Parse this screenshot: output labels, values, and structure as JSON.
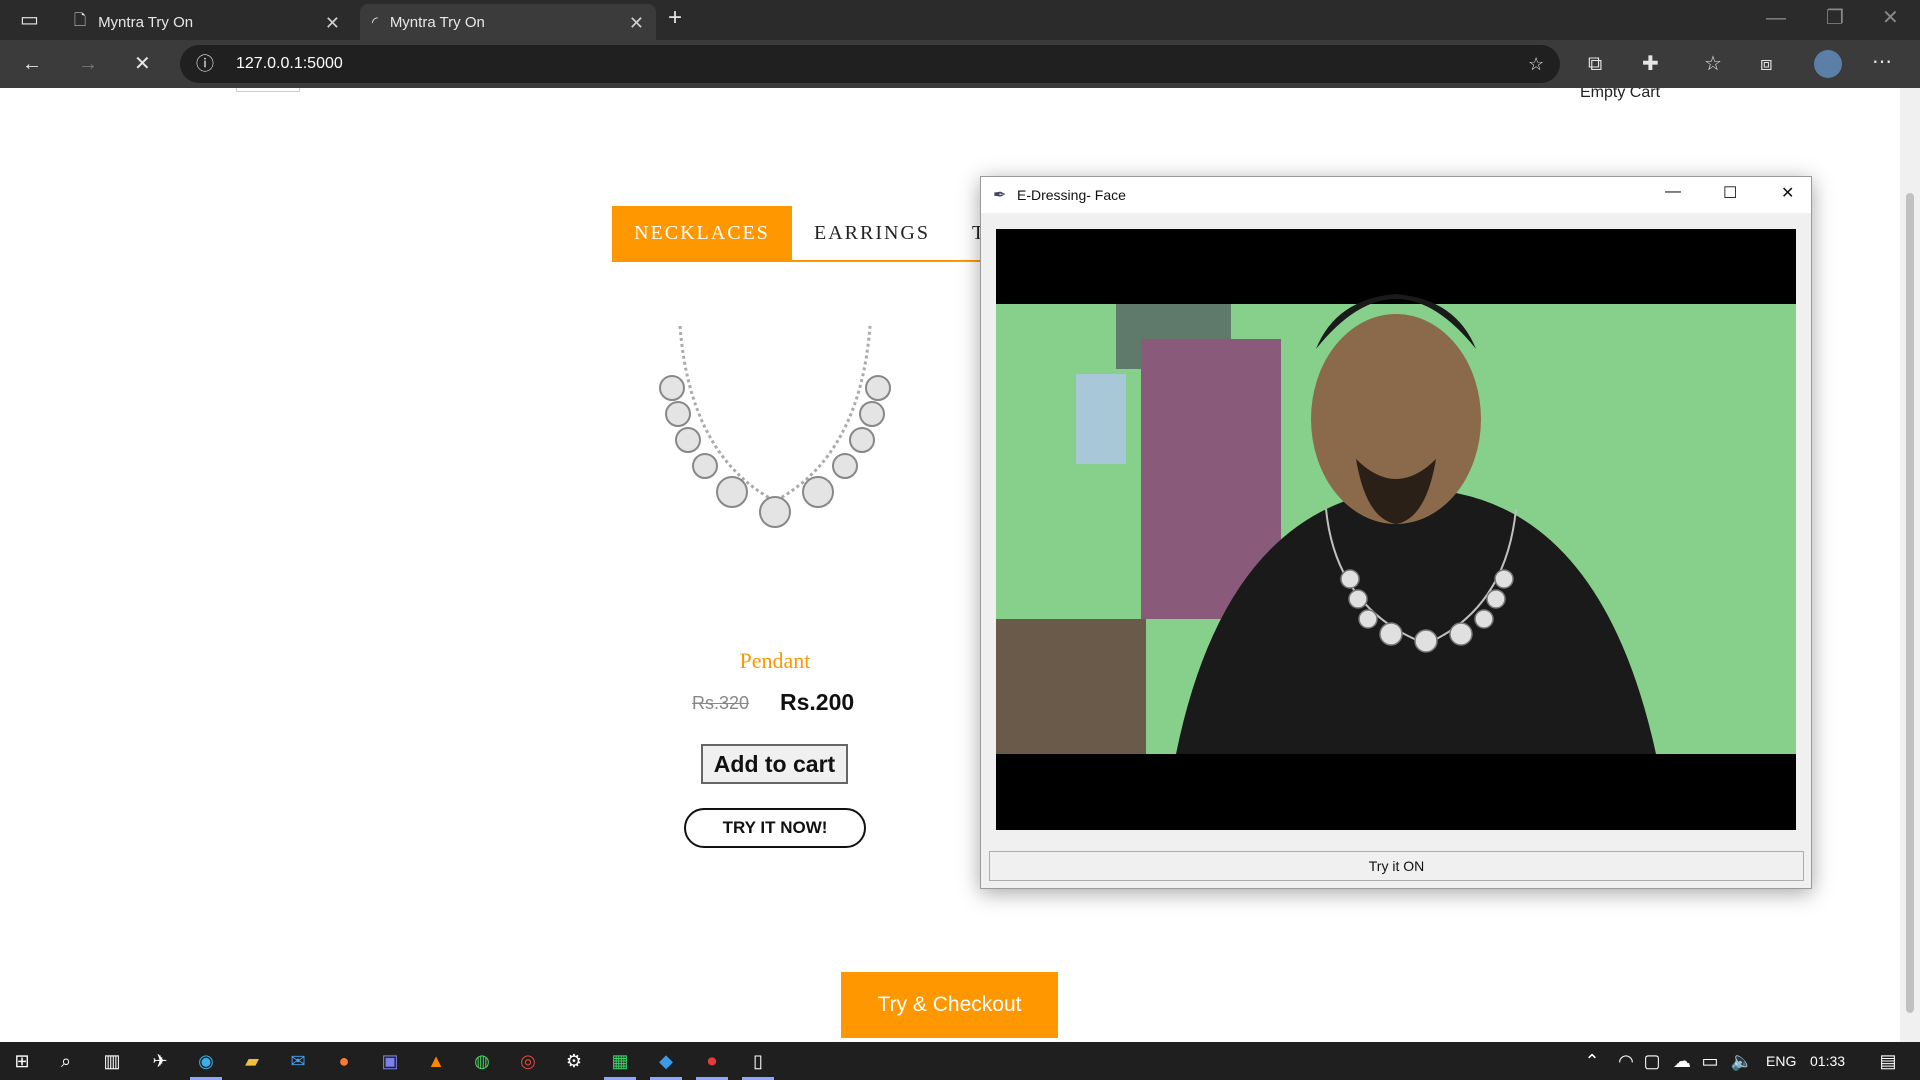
{
  "browser": {
    "tabs": [
      {
        "title": "Myntra Try On"
      },
      {
        "title": "Myntra Try On"
      }
    ],
    "url": "127.0.0.1:5000"
  },
  "page": {
    "empty_cart": "Empty Cart",
    "categories": [
      "NECKLACES",
      "EARRINGS",
      "T"
    ],
    "product": {
      "name": "Pendant",
      "old_price": "Rs.320",
      "new_price": "Rs.200",
      "add_to_cart": "Add to cart",
      "try_now": "TRY IT NOW!"
    },
    "checkout": "Try & Checkout"
  },
  "popup": {
    "title": "E-Dressing- Face",
    "try_on_button": "Try it ON"
  },
  "taskbar": {
    "lang": "ENG",
    "time": "01:33"
  },
  "colors": {
    "accent": "#ff9800"
  }
}
